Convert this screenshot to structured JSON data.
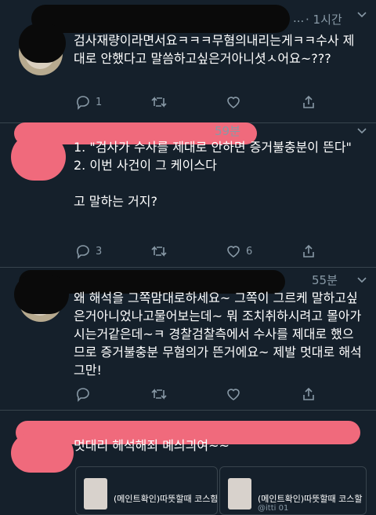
{
  "tweets": [
    {
      "time": "· 1시간",
      "text": "검사재량이라면서요ㅋㅋㅋ무혐의내리는게ㅋㅋ수사 제대로 안했다고 말씀하고싶은거아니셧ㅅ어요~???",
      "replies": "1",
      "retweets": "",
      "likes": ""
    },
    {
      "time": "59분",
      "text": "1. \"검사가 수사를 제대로 안하면 증거불충분이 뜬다\"\n2. 이번 사건이 그 케이스다\n\n고 말하는 거지?",
      "replies": "3",
      "retweets": "",
      "likes": "6"
    },
    {
      "time": "55분",
      "text": "왜 해석을 그쪽맘대로하세요~ 그쪽이 그르케 말하고싶은거아니었나고물어보는데~ 뭐 조치취하시려고 몰아가시는거같은데~ㅋ 경찰검찰측에서 수사를 제대로 했으므로 증거불충분 무혐의가 뜬거에요~ 제발 멋대로 해석그만!",
      "replies": "",
      "retweets": "",
      "likes": ""
    },
    {
      "time": "",
      "text": "멋대리 헤석해죄 몌싀긔여~~"
    }
  ],
  "cards": [
    {
      "title": "(메인트확인)따뜻할때 코스함",
      "subtitle": ""
    },
    {
      "title": "(메인트확인)따뜻할때 코스할 니티",
      "subtitle": "@itti 01"
    }
  ],
  "icons": {
    "reply": "reply-icon",
    "retweet": "retweet-icon",
    "like": "heart-icon",
    "share": "share-icon",
    "caret": "chevron-down-icon"
  },
  "colors": {
    "background": "#15202b",
    "text": "#ffffff",
    "muted": "#8899a6",
    "divider": "#38444d",
    "redaction_pink": "#f06a7c"
  }
}
